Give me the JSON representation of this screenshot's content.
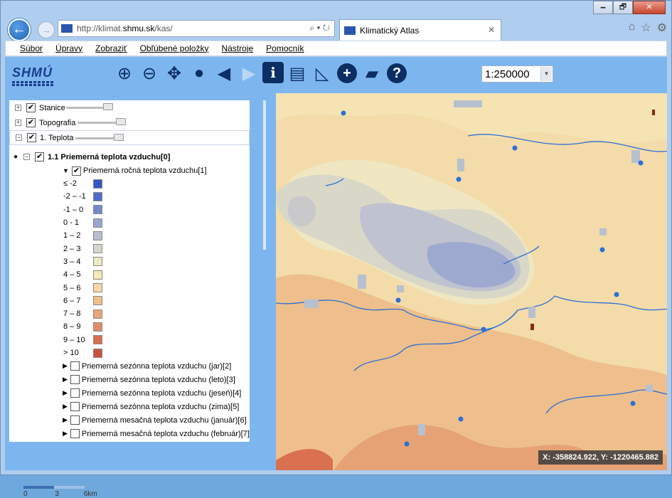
{
  "browser": {
    "window_controls": {
      "minimize": "🗕",
      "restore": "🗗",
      "close": "✕"
    },
    "address": {
      "prefix": "http://klimat.",
      "domain": "shmu.sk",
      "path": "/kas/"
    },
    "tab": {
      "title": "Klimatický Atlas",
      "close": "✕"
    },
    "menu": [
      "Súbor",
      "Úpravy",
      "Zobraziť",
      "Obľúbené položky",
      "Nástroje",
      "Pomocník"
    ]
  },
  "app": {
    "logo": "SHMÚ",
    "tools": [
      "zoom-in",
      "zoom-out",
      "pan",
      "globe",
      "back",
      "forward",
      "info",
      "print",
      "measure",
      "add",
      "slovakia",
      "help"
    ],
    "scale": "1:250000"
  },
  "layers": {
    "stanice": "Stanice",
    "topografia": "Topografia",
    "teplota": "1. Teplota",
    "group": "1.1 Priemerná teplota vzduchu[0]",
    "annual": "Priemerná ročná teplota vzduchu[1]",
    "legend": [
      {
        "label": "≤ -2",
        "color": "#2f58c4"
      },
      {
        "label": "-2 – -1",
        "color": "#4d6cc8"
      },
      {
        "label": "-1 – 0",
        "color": "#7389cc"
      },
      {
        "label": "0 - 1",
        "color": "#9aa7cf"
      },
      {
        "label": "1 – 2",
        "color": "#b9bfcf"
      },
      {
        "label": "2 – 3",
        "color": "#d6d6cc"
      },
      {
        "label": "3 – 4",
        "color": "#eeeac4"
      },
      {
        "label": "4 – 5",
        "color": "#f7ebb4"
      },
      {
        "label": "5 – 6",
        "color": "#f6d9a2"
      },
      {
        "label": "6 – 7",
        "color": "#f1bf8a"
      },
      {
        "label": "7 – 8",
        "color": "#eba576"
      },
      {
        "label": "8 – 9",
        "color": "#e38c63"
      },
      {
        "label": "9 – 10",
        "color": "#d9704f"
      },
      {
        "label": "> 10",
        "color": "#c9503e"
      }
    ],
    "sublayers": [
      "Priemerná sezónna teplota vzduchu (jar)[2]",
      "Priemerná sezónna teplota vzduchu (leto)[3]",
      "Priemerná sezónna teplota vzduchu (jeseň)[4]",
      "Priemerná sezónna teplota vzduchu (zima)[5]",
      "Priemerná mesačná teplota vzduchu (január)[6]",
      "Priemerná mesačná teplota vzduchu (február)[7]"
    ]
  },
  "scalebar": {
    "ticks": [
      "0",
      "3",
      "6km"
    ]
  },
  "map": {
    "coords": "X: -358824.922, Y: -1220465.882"
  }
}
